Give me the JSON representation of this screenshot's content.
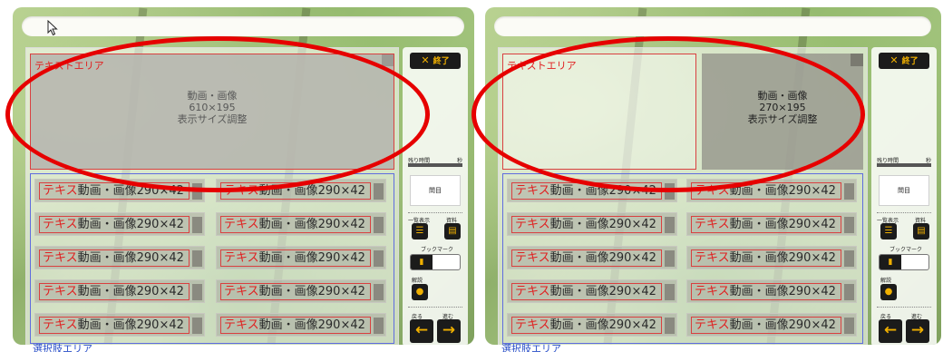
{
  "panels": [
    {
      "text_area_label": "テキストエリア",
      "media_lines": [
        "動画・画像",
        "610×195",
        "表示サイズ調整"
      ],
      "cells": [
        {
          "a": "テキス",
          "b": "動画・画像290×42"
        },
        {
          "a": "テキス",
          "b": "動画・画像290×42"
        },
        {
          "a": "テキス",
          "b": "動画・画像290×42"
        },
        {
          "a": "テキス",
          "b": "動画・画像290×42"
        },
        {
          "a": "テキス",
          "b": "動画・画像290×42"
        },
        {
          "a": "テキス",
          "b": "動画・画像290×42"
        },
        {
          "a": "テキス",
          "b": "動画・画像290×42"
        },
        {
          "a": "テキス",
          "b": "動画・画像290×42"
        },
        {
          "a": "テキス",
          "b": "動画・画像290×42"
        },
        {
          "a": "テキス",
          "b": "動画・画像290×42"
        }
      ],
      "bottom_label": "選択肢エリア",
      "side": {
        "end_label": "終了",
        "remain_label": "残り時間",
        "remain_unit": "秒",
        "page_label": "問目",
        "list_label": "一覧表示",
        "material_label": "資料",
        "bookmark_label": "ブックマーク",
        "explain_label": "解説",
        "back_label": "戻る",
        "forward_label": "進む"
      }
    },
    {
      "text_area_label": "テキストエリア",
      "media_lines": [
        "動画・画像",
        "270×195",
        "表示サイズ調整"
      ],
      "cells": [
        {
          "a": "テキス",
          "b": "動画・画像290×42"
        },
        {
          "a": "テキス",
          "b": "動画・画像290×42"
        },
        {
          "a": "テキス",
          "b": "動画・画像290×42"
        },
        {
          "a": "テキス",
          "b": "動画・画像290×42"
        },
        {
          "a": "テキス",
          "b": "動画・画像290×42"
        },
        {
          "a": "テキス",
          "b": "動画・画像290×42"
        },
        {
          "a": "テキス",
          "b": "動画・画像290×42"
        },
        {
          "a": "テキス",
          "b": "動画・画像290×42"
        },
        {
          "a": "テキス",
          "b": "動画・画像290×42"
        },
        {
          "a": "テキス",
          "b": "動画・画像290×42"
        }
      ],
      "bottom_label": "選択肢エリア",
      "side": {
        "end_label": "終了",
        "remain_label": "残り時間",
        "remain_unit": "秒",
        "page_label": "問目",
        "list_label": "一覧表示",
        "material_label": "資料",
        "bookmark_label": "ブックマーク",
        "explain_label": "解説",
        "back_label": "戻る",
        "forward_label": "進む"
      }
    }
  ],
  "colors": {
    "annotation_ellipse": "#e60000",
    "text_area_border": "#d94040",
    "choice_area_border": "#5f6cdf",
    "button_bg": "#1b1b1b",
    "button_icon": "#f0b000"
  },
  "icons": {
    "end": "close-icon",
    "list": "list-icon",
    "material": "document-icon",
    "bookmark": "bookmark-icon",
    "explain": "comment-icon",
    "back": "arrow-left-icon",
    "forward": "arrow-right-icon",
    "pointer": "mouse-cursor-icon"
  }
}
